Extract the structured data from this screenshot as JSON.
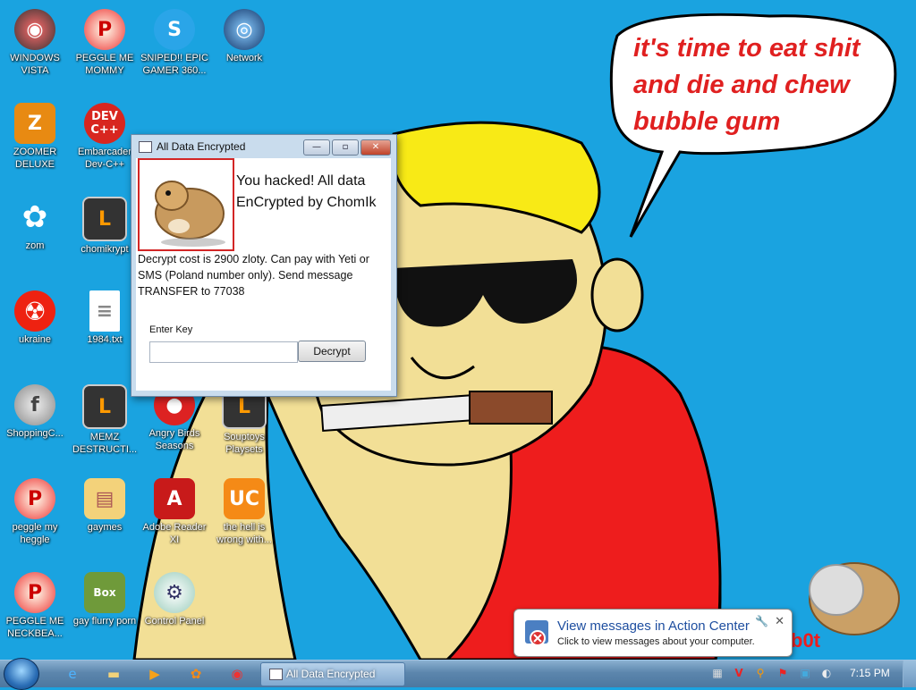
{
  "wallpaper": {
    "speech_lines": [
      "it's time to eat shit",
      "and die and chew",
      "bubble gum"
    ],
    "corner_text": "b0t",
    "background_color": "#1aa3e0"
  },
  "desktop_icons": [
    {
      "label": "WINDOWS VISTA",
      "icon": "windows-vista-orb-icon"
    },
    {
      "label": "PEGGLE ME MOMMY",
      "icon": "peggle-icon"
    },
    {
      "label": "SNIPED!! EPIC GAMER 360...",
      "icon": "skype-icon"
    },
    {
      "label": "Network",
      "icon": "network-icon"
    },
    {
      "label": "ZOOMER DELUXE",
      "icon": "zoomer-icon"
    },
    {
      "label": "Embarcader Dev-C++",
      "icon": "dev-cpp-icon"
    },
    {
      "label": "zom",
      "icon": "flower-icon"
    },
    {
      "label": "chomikrypt",
      "icon": "shortcut-icon"
    },
    {
      "label": "ukraine",
      "icon": "radiation-icon"
    },
    {
      "label": "1984.txt",
      "icon": "text-file-icon"
    },
    {
      "label": "ShoppingC...",
      "icon": "flash-icon"
    },
    {
      "label": "MEMZ DESTRUCTI...",
      "icon": "shortcut-icon"
    },
    {
      "label": "Angry Birds Seasons",
      "icon": "angry-birds-icon"
    },
    {
      "label": "Souptoys Playsets",
      "icon": "shortcut-icon"
    },
    {
      "label": "peggle my heggle",
      "icon": "peggle-icon"
    },
    {
      "label": "gaymes",
      "icon": "folder-icon"
    },
    {
      "label": "Adobe Reader XI",
      "icon": "adobe-reader-icon"
    },
    {
      "label": "the hell is wrong with...",
      "icon": "uc-browser-icon"
    },
    {
      "label": "PEGGLE ME NECKBEA...",
      "icon": "peggle-icon"
    },
    {
      "label": "gay flurry porn",
      "icon": "box-hamster-icon"
    },
    {
      "label": "Control Panel",
      "icon": "control-panel-icon"
    }
  ],
  "dialog": {
    "title": "All Data Encrypted",
    "headline": "You hacked! All data EnCrypted by ChomIk",
    "body": "Decrypt cost is 2900 zloty. Can pay with Yeti or SMS (Poland number only). Send message TRANSFER to 77038",
    "key_label": "Enter Key",
    "key_value": "",
    "decrypt_label": "Decrypt",
    "minimize_glyph": "—",
    "maximize_glyph": "▫",
    "close_glyph": "✕"
  },
  "notification": {
    "title": "View messages in Action Center",
    "subtitle": "Click to view messages about your computer.",
    "close_glyph": "✕",
    "wrench_glyph": "🔧"
  },
  "taskbar": {
    "pinned": [
      "internet-explorer-icon",
      "explorer-folder-icon",
      "media-player-icon",
      "uc-browser-icon",
      "chrome-icon"
    ],
    "active_task": "All Data Encrypted",
    "tray": [
      "network-tray-icon",
      "antivirus-tray-icon",
      "search-tray-icon",
      "action-center-flag-icon",
      "display-tray-icon",
      "volume-tray-icon"
    ],
    "clock": "7:15 PM"
  }
}
